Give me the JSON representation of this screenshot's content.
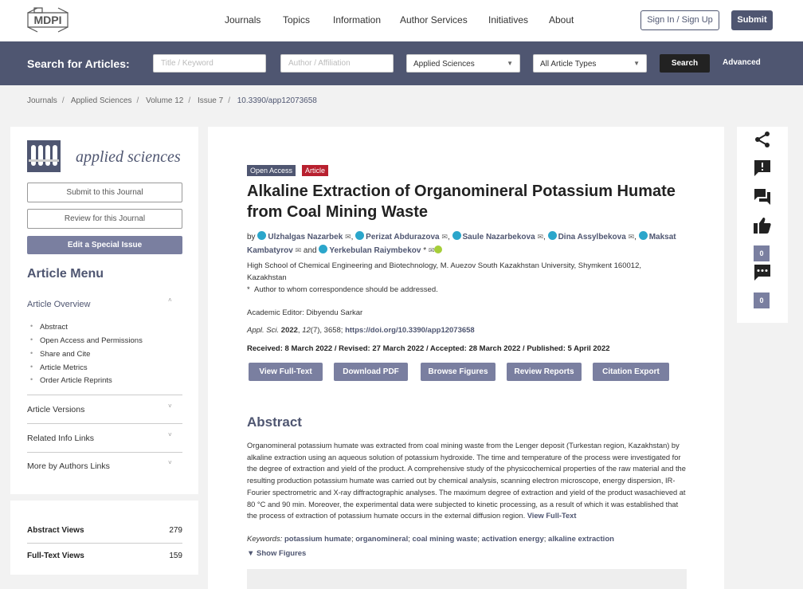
{
  "header": {
    "logo_text": "MDPI",
    "nav": [
      "Journals",
      "Topics",
      "Information",
      "Author Services",
      "Initiatives",
      "About"
    ],
    "sign_in": "Sign In / Sign Up",
    "submit": "Submit"
  },
  "search": {
    "label": "Search for Articles:",
    "title_placeholder": "Title / Keyword",
    "author_placeholder": "Author / Affiliation",
    "journal_value": "Applied Sciences",
    "type_value": "All Article Types",
    "button": "Search",
    "advanced": "Advanced"
  },
  "breadcrumb": [
    "Journals",
    "Applied Sciences",
    "Volume 12",
    "Issue 7",
    "10.3390/app12073658"
  ],
  "sidebar": {
    "journal_name": "applied sciences",
    "submit_btn": "Submit to this Journal",
    "review_btn": "Review for this Journal",
    "edit_btn": "Edit a Special Issue",
    "menu_title": "Article Menu",
    "overview": "Article Overview",
    "overview_items": [
      "Abstract",
      "Open Access and Permissions",
      "Share and Cite",
      "Article Metrics",
      "Order Article Reprints"
    ],
    "sections": [
      "Article Versions",
      "Related Info Links",
      "More by Authors Links"
    ]
  },
  "stats": {
    "abstract_label": "Abstract Views",
    "abstract_value": "279",
    "fulltext_label": "Full-Text Views",
    "fulltext_value": "159"
  },
  "article": {
    "tag_open": "Open Access",
    "tag_article": "Article",
    "title": "Alkaline Extraction of Organomineral Potassium Humate from Coal Mining Waste",
    "by": "by",
    "authors": [
      "Ulzhalgas Nazarbek",
      "Perizat Abdurazova",
      "Saule Nazarbekova",
      "Dina Assylbekova",
      "Maksat Kambatyrov",
      "Yerkebulan Raiymbekov"
    ],
    "and": "and",
    "affiliation": "High School of Chemical Engineering and Biotechnology, M. Auezov South Kazakhstan University, Shymkent 160012, Kazakhstan",
    "corresponding": "Author to whom correspondence should be addressed.",
    "editor": "Academic Editor: Dibyendu Sarkar",
    "citation_journal": "Appl. Sci.",
    "citation_year": "2022",
    "citation_vol": "12",
    "citation_rest": "(7), 3658;",
    "doi": "https://doi.org/10.3390/app12073658",
    "dates": "Received: 8 March 2022 / Revised: 27 March 2022 / Accepted: 28 March 2022 / Published: 5 April 2022",
    "buttons": [
      "View Full-Text",
      "Download PDF",
      "Browse Figures",
      "Review Reports",
      "Citation Export"
    ],
    "abstract_heading": "Abstract",
    "abstract": "Organomineral potassium humate was extracted from coal mining waste from the Lenger deposit (Turkestan region, Kazakhstan) by alkaline extraction using an aqueous solution of potassium hydroxide. The time and temperature of the process were investigated for the degree of extraction and yield of the product. A comprehensive study of the physicochemical properties of the raw material and the resulting production potassium humate was carried out by chemical analysis, scanning electron microscope, energy dispersion, IR-Fourier spectrometric and X-ray diffractographic analyses. The maximum degree of extraction and yield of the product wasachieved at 80 °C and 90 min. Moreover, the experimental data were subjected to kinetic processing, as a result of which it was established that the process of extraction of potassium humate occurs in the external diffusion region.",
    "view_full": "View Full-Text",
    "keywords_label": "Keywords:",
    "keywords": [
      "potassium humate",
      "organomineral",
      "coal mining waste",
      "activation energy",
      "alkaline extraction"
    ],
    "show_figures": "Show Figures"
  },
  "tools": {
    "like_count": "0",
    "comment_count": "0"
  }
}
